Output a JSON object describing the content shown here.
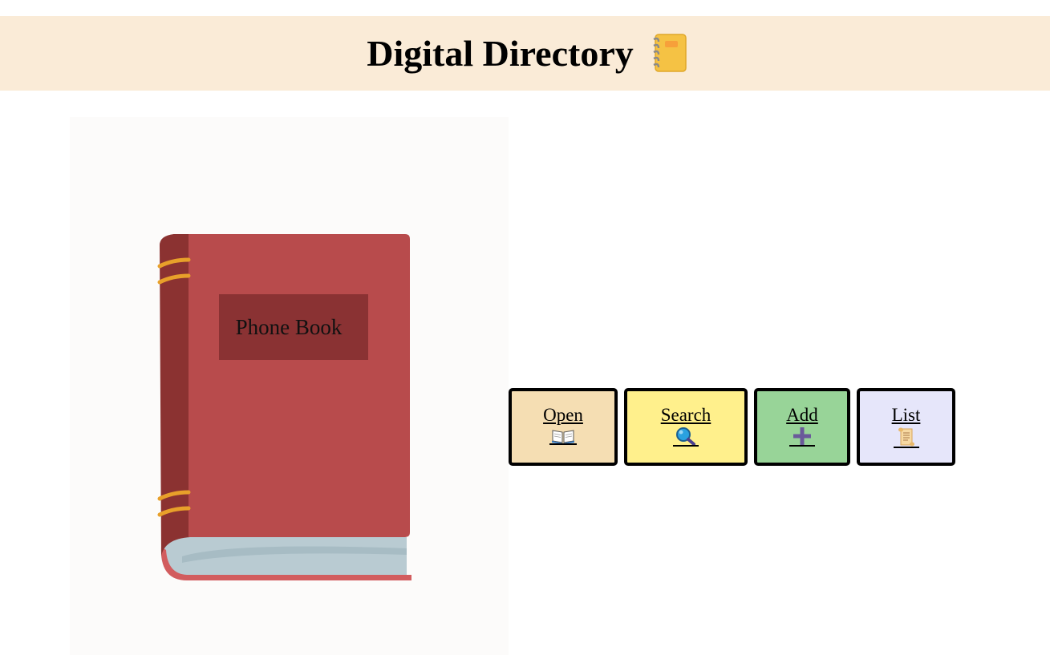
{
  "header": {
    "title": "Digital Directory",
    "icon": "notebook-icon"
  },
  "book": {
    "cover_text": "Phone Book",
    "cover_color": "#b84b4c",
    "spine_color": "#87302f",
    "stripe_color": "#e8a02a"
  },
  "menu": {
    "items": [
      {
        "label": "Open",
        "icon": "open-book-icon",
        "color": "#f5deb3"
      },
      {
        "label": "Search",
        "icon": "magnifier-icon",
        "color": "#fff08c"
      },
      {
        "label": "Add",
        "icon": "plus-icon",
        "color": "#98d498"
      },
      {
        "label": "List",
        "icon": "scroll-icon",
        "color": "#e6e6fa"
      }
    ]
  }
}
